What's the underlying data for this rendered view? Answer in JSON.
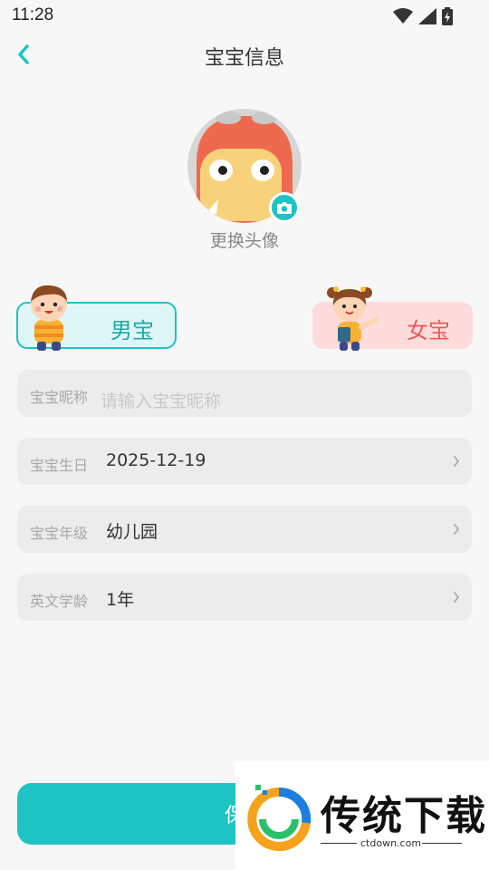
{
  "status_bar": {
    "time": "11:28"
  },
  "nav": {
    "title": "宝宝信息"
  },
  "avatar": {
    "caption": "更换头像"
  },
  "gender": {
    "boy_label": "男宝",
    "girl_label": "女宝"
  },
  "fields": {
    "nickname": {
      "label": "宝宝昵称",
      "placeholder": "请输入宝宝昵称",
      "value": ""
    },
    "birthday": {
      "label": "宝宝生日",
      "value": "2025-12-19"
    },
    "grade": {
      "label": "宝宝年级",
      "value": "幼儿园"
    },
    "english_age": {
      "label": "英文学龄",
      "value": "1年"
    }
  },
  "save_button": {
    "label": "保存"
  },
  "watermark": {
    "title": "传统下载",
    "url": "ctdown.com"
  },
  "colors": {
    "accent": "#1ec3c3",
    "boy_bg": "#dff6f6",
    "girl_bg": "#ffdcdc",
    "girl_text": "#e85a5a",
    "field_bg": "#ececec"
  },
  "icons": {
    "back": "chevron-left-icon",
    "camera": "camera-icon",
    "wifi": "wifi-icon",
    "signal": "signal-icon",
    "battery": "battery-icon"
  }
}
